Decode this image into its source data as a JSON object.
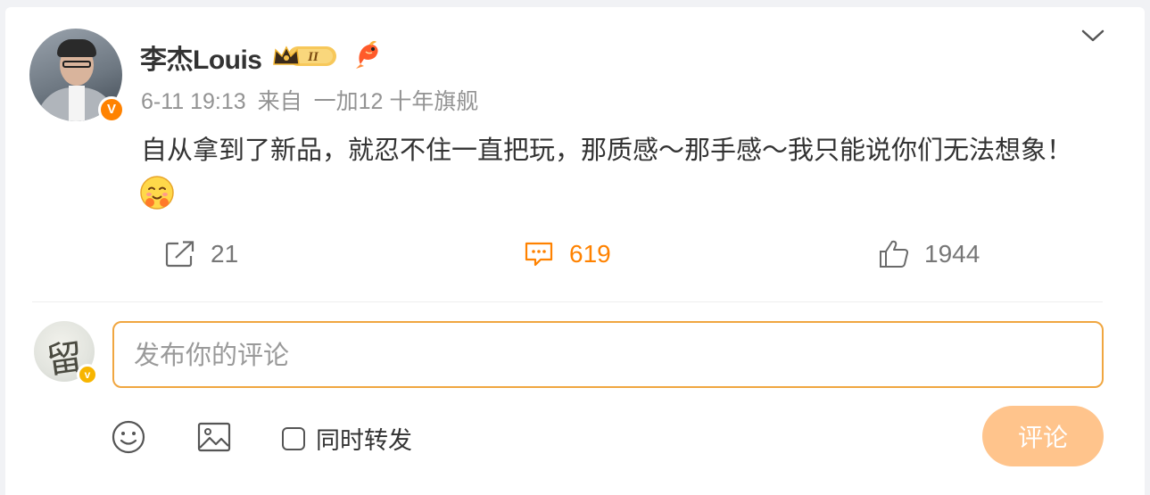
{
  "post": {
    "author": "李杰Louis",
    "level_badge": "II",
    "time": "6-11 19:13",
    "source_prefix": "来自",
    "source": "一加12 十年旗舰",
    "text": "自从拿到了新品，就忍不住一直把玩，那质感～那手感～我只能说你们无法想象！",
    "verified_label": "V"
  },
  "actions": {
    "repost_count": "21",
    "comment_count": "619",
    "like_count": "1944"
  },
  "composer": {
    "placeholder": "发布你的评论",
    "repost_label": "同时转发",
    "submit_label": "评论",
    "avatar_glyph": "留",
    "verified_label": "v"
  },
  "colors": {
    "accent": "#ff8200",
    "submit_disabled": "#ffc48c",
    "input_border": "#f0a640"
  },
  "icons": {
    "more": "chevron-down-icon",
    "repost": "share-icon",
    "comment": "comment-icon",
    "like": "thumbs-up-icon",
    "emoji": "smiley-icon",
    "image": "image-icon"
  }
}
